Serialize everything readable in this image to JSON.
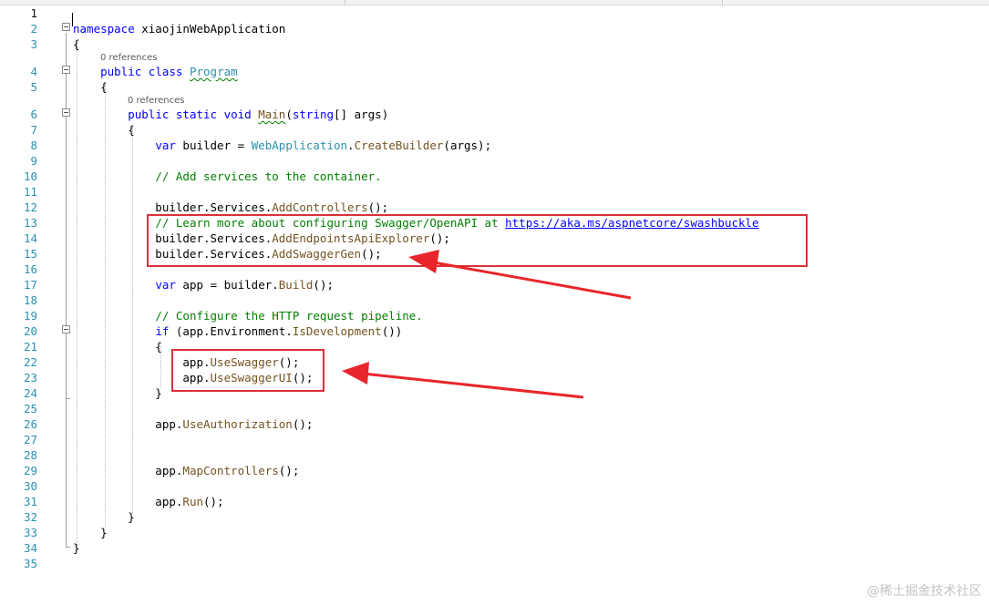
{
  "editor": {
    "codelens_references": "0 references",
    "lines": [
      {
        "n": "1",
        "tokens": []
      },
      {
        "n": "2",
        "tokens": [
          {
            "t": "namespace",
            "c": "kw"
          },
          {
            "t": " xiaojinWebApplication",
            "c": ""
          }
        ]
      },
      {
        "n": "3",
        "tokens": [
          {
            "t": "{",
            "c": ""
          }
        ]
      },
      {
        "n": "4",
        "tokens": [
          {
            "t": "    ",
            "c": ""
          },
          {
            "t": "public",
            "c": "kw"
          },
          {
            "t": " ",
            "c": ""
          },
          {
            "t": "class",
            "c": "kw"
          },
          {
            "t": " ",
            "c": ""
          },
          {
            "t": "Program",
            "c": "ty squig"
          }
        ]
      },
      {
        "n": "5",
        "tokens": [
          {
            "t": "    {",
            "c": ""
          }
        ]
      },
      {
        "n": "6",
        "tokens": [
          {
            "t": "        ",
            "c": ""
          },
          {
            "t": "public",
            "c": "kw"
          },
          {
            "t": " ",
            "c": ""
          },
          {
            "t": "static",
            "c": "kw"
          },
          {
            "t": " ",
            "c": ""
          },
          {
            "t": "void",
            "c": "kw"
          },
          {
            "t": " ",
            "c": ""
          },
          {
            "t": "Main",
            "c": "mt squig"
          },
          {
            "t": "(",
            "c": ""
          },
          {
            "t": "string",
            "c": "kw"
          },
          {
            "t": "[] args)",
            "c": ""
          }
        ]
      },
      {
        "n": "7",
        "tokens": [
          {
            "t": "        {",
            "c": ""
          }
        ]
      },
      {
        "n": "8",
        "tokens": [
          {
            "t": "            ",
            "c": ""
          },
          {
            "t": "var",
            "c": "kw"
          },
          {
            "t": " builder = ",
            "c": ""
          },
          {
            "t": "WebApplication",
            "c": "ty"
          },
          {
            "t": ".",
            "c": ""
          },
          {
            "t": "CreateBuilder",
            "c": "mt"
          },
          {
            "t": "(args);",
            "c": ""
          }
        ]
      },
      {
        "n": "9",
        "tokens": []
      },
      {
        "n": "10",
        "tokens": [
          {
            "t": "            ",
            "c": ""
          },
          {
            "t": "// Add services to the container.",
            "c": "cm"
          }
        ]
      },
      {
        "n": "11",
        "tokens": []
      },
      {
        "n": "12",
        "tokens": [
          {
            "t": "            builder.Services.",
            "c": ""
          },
          {
            "t": "AddControllers",
            "c": "mt"
          },
          {
            "t": "();",
            "c": ""
          }
        ]
      },
      {
        "n": "13",
        "tokens": [
          {
            "t": "            ",
            "c": ""
          },
          {
            "t": "// Learn more about configuring Swagger/OpenAPI at ",
            "c": "cm"
          },
          {
            "t": "https://aka.ms/aspnetcore/swashbuckle",
            "c": "url"
          }
        ]
      },
      {
        "n": "14",
        "tokens": [
          {
            "t": "            builder.Services.",
            "c": ""
          },
          {
            "t": "AddEndpointsApiExplorer",
            "c": "mt"
          },
          {
            "t": "();",
            "c": ""
          }
        ]
      },
      {
        "n": "15",
        "tokens": [
          {
            "t": "            builder.Services.",
            "c": ""
          },
          {
            "t": "AddSwaggerGen",
            "c": "mt"
          },
          {
            "t": "();",
            "c": ""
          }
        ]
      },
      {
        "n": "16",
        "tokens": []
      },
      {
        "n": "17",
        "tokens": [
          {
            "t": "            ",
            "c": ""
          },
          {
            "t": "var",
            "c": "kw"
          },
          {
            "t": " app = builder.",
            "c": ""
          },
          {
            "t": "Build",
            "c": "mt"
          },
          {
            "t": "();",
            "c": ""
          }
        ]
      },
      {
        "n": "18",
        "tokens": []
      },
      {
        "n": "19",
        "tokens": [
          {
            "t": "            ",
            "c": ""
          },
          {
            "t": "// Configure the HTTP request pipeline.",
            "c": "cm"
          }
        ]
      },
      {
        "n": "20",
        "tokens": [
          {
            "t": "            ",
            "c": ""
          },
          {
            "t": "if",
            "c": "kw"
          },
          {
            "t": " (app.Environment.",
            "c": ""
          },
          {
            "t": "IsDevelopment",
            "c": "mt"
          },
          {
            "t": "())",
            "c": ""
          }
        ]
      },
      {
        "n": "21",
        "tokens": [
          {
            "t": "            {",
            "c": ""
          }
        ]
      },
      {
        "n": "22",
        "tokens": [
          {
            "t": "                app.",
            "c": ""
          },
          {
            "t": "UseSwagger",
            "c": "mt"
          },
          {
            "t": "();",
            "c": ""
          }
        ]
      },
      {
        "n": "23",
        "tokens": [
          {
            "t": "                app.",
            "c": ""
          },
          {
            "t": "UseSwaggerUI",
            "c": "mt"
          },
          {
            "t": "();",
            "c": ""
          }
        ]
      },
      {
        "n": "24",
        "tokens": [
          {
            "t": "            }",
            "c": ""
          }
        ]
      },
      {
        "n": "25",
        "tokens": []
      },
      {
        "n": "26",
        "tokens": [
          {
            "t": "            app.",
            "c": ""
          },
          {
            "t": "UseAuthorization",
            "c": "mt"
          },
          {
            "t": "();",
            "c": ""
          }
        ]
      },
      {
        "n": "27",
        "tokens": []
      },
      {
        "n": "28",
        "tokens": []
      },
      {
        "n": "29",
        "tokens": [
          {
            "t": "            app.",
            "c": ""
          },
          {
            "t": "MapControllers",
            "c": "mt"
          },
          {
            "t": "();",
            "c": ""
          }
        ]
      },
      {
        "n": "30",
        "tokens": []
      },
      {
        "n": "31",
        "tokens": [
          {
            "t": "            app.",
            "c": ""
          },
          {
            "t": "Run",
            "c": "mt"
          },
          {
            "t": "();",
            "c": ""
          }
        ]
      },
      {
        "n": "32",
        "tokens": [
          {
            "t": "        }",
            "c": ""
          }
        ]
      },
      {
        "n": "33",
        "tokens": [
          {
            "t": "    }",
            "c": ""
          }
        ]
      },
      {
        "n": "34",
        "tokens": [
          {
            "t": "}",
            "c": ""
          }
        ]
      },
      {
        "n": "35",
        "tokens": []
      }
    ]
  },
  "annotation": {
    "box_color": "#d9313a",
    "arrow_color": "#e8262b"
  },
  "watermark": "@稀土掘金技术社区"
}
